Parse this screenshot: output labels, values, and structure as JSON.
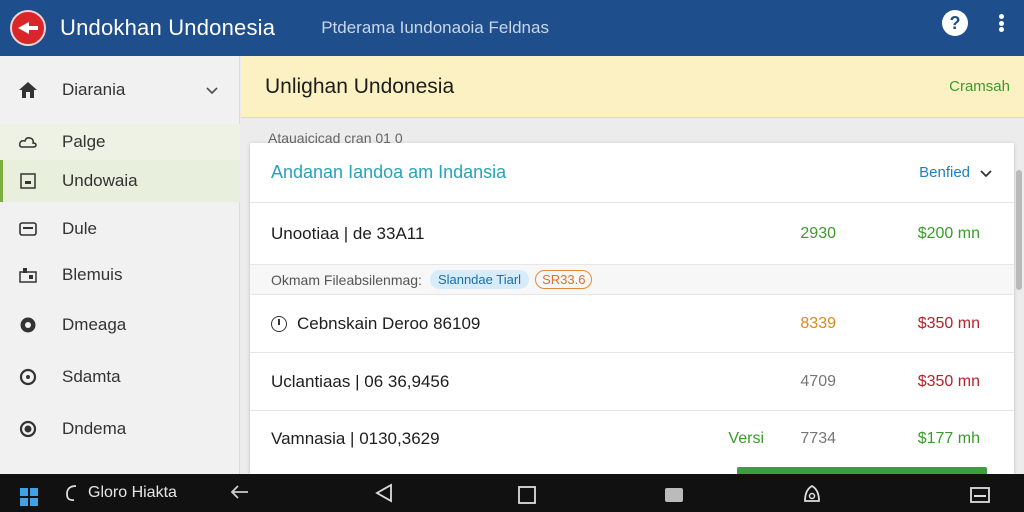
{
  "app": {
    "title": "Undokhan Undonesia",
    "subtitle": "Ptderama Iundonaoia Feldnas",
    "help_icon": "help-icon",
    "more_icon": "more-vert-icon"
  },
  "sidebar": {
    "items": [
      {
        "label": "Diarania",
        "icon": "home-icon",
        "has_chevron": true
      },
      {
        "label": "Palge",
        "icon": "cloud-icon"
      },
      {
        "label": "Undowaia",
        "icon": "square-icon"
      },
      {
        "label": "Dule",
        "icon": "rect-icon"
      },
      {
        "label": "Blemuis",
        "icon": "grid-icon"
      },
      {
        "label": "Dmeaga",
        "icon": "circle-icon"
      },
      {
        "label": "Sdamta",
        "icon": "ring-icon"
      },
      {
        "label": "Dndema",
        "icon": "dot-circle-icon"
      }
    ]
  },
  "banner": {
    "title": "Unlighan Undonesia",
    "action": "Cramsah"
  },
  "subline": "Atauaicicad cran      01 0",
  "card": {
    "title": "Andanan Iandoa am Indansia",
    "filter_label": "Benfied",
    "rows": [
      {
        "label": "Unootiaa | de 33A11",
        "value": "2930",
        "amount": "$200 mn"
      },
      {
        "label": "Cebnskain Deroo 86109",
        "value": "8339",
        "amount": "$350 mn"
      },
      {
        "label": "Uclantiaas | 06 36,9456",
        "value": "4709",
        "amount": "$350 mn"
      },
      {
        "label": "Vamnasia | 0130,3629",
        "tag": "Versi",
        "value": "7734",
        "amount": "$177 mh"
      }
    ],
    "meta": {
      "text": "Okmam Fileabsilenmag:",
      "chip_blue": "Slanndae Tiarl",
      "chip_orange": "SR33.6"
    }
  },
  "colors": {
    "appbar": "#1f4e8c",
    "banner": "#fbf1c2",
    "accent_green": "#3a9b2b",
    "accent_red": "#b4232b",
    "accent_orange": "#d88a1c",
    "link_blue": "#1e7fc1"
  },
  "taskbar": {
    "app_label": "Gloro Hiakta",
    "start_icon": "windows-start-icon",
    "search_icon": "cortana-icon",
    "back_icon": "back-arrow-icon",
    "nav_back_icon": "nav-back-triangle-icon",
    "home_icon": "nav-home-square-icon",
    "recent_icon": "nav-recent-icon",
    "notify_icon": "notification-icon",
    "tray_icon": "tray-window-icon"
  }
}
